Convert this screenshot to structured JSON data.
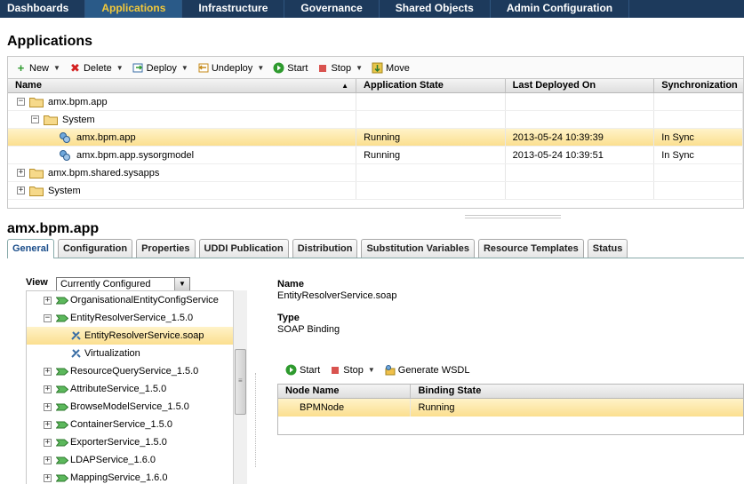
{
  "nav": {
    "tabs": [
      "Dashboards",
      "Applications",
      "Infrastructure",
      "Governance",
      "Shared Objects",
      "Admin Configuration"
    ],
    "active": "Applications"
  },
  "page_title": "Applications",
  "toolbar": {
    "new": "New",
    "delete": "Delete",
    "deploy": "Deploy",
    "undeploy": "Undeploy",
    "start": "Start",
    "stop": "Stop",
    "move": "Move"
  },
  "grid": {
    "columns": [
      "Name",
      "Application State",
      "Last Deployed On",
      "Synchronization"
    ],
    "rows": [
      {
        "name": "amx.bpm.app",
        "state": "",
        "deployed": "",
        "sync": ""
      },
      {
        "name": "System",
        "state": "",
        "deployed": "",
        "sync": ""
      },
      {
        "name": "amx.bpm.app",
        "state": "Running",
        "deployed": "2013-05-24 10:39:39",
        "sync": "In Sync"
      },
      {
        "name": "amx.bpm.app.sysorgmodel",
        "state": "Running",
        "deployed": "2013-05-24 10:39:51",
        "sync": "In Sync"
      },
      {
        "name": "amx.bpm.shared.sysapps",
        "state": "",
        "deployed": "",
        "sync": ""
      },
      {
        "name": "System",
        "state": "",
        "deployed": "",
        "sync": ""
      }
    ]
  },
  "detail_title": "amx.bpm.app",
  "detail_tabs": [
    "General",
    "Configuration",
    "Properties",
    "UDDI Publication",
    "Distribution",
    "Substitution Variables",
    "Resource Templates",
    "Status"
  ],
  "view": {
    "label": "View",
    "selected": "Currently Configured"
  },
  "tree": [
    "OrganisationalEntityConfigService",
    "EntityResolverService_1.5.0",
    "EntityResolverService.soap",
    "Virtualization",
    "ResourceQueryService_1.5.0",
    "AttributeService_1.5.0",
    "BrowseModelService_1.5.0",
    "ContainerService_1.5.0",
    "ExporterService_1.5.0",
    "LDAPService_1.6.0",
    "MappingService_1.6.0"
  ],
  "binding": {
    "name_label": "Name",
    "name_value": "EntityResolverService.soap",
    "type_label": "Type",
    "type_value": "SOAP Binding",
    "start": "Start",
    "stop": "Stop",
    "generate": "Generate WSDL",
    "columns": [
      "Node Name",
      "Binding State"
    ],
    "rows": [
      {
        "node": "BPMNode",
        "state": "Running"
      }
    ]
  },
  "colors": {
    "nav_bg": "#1d3a5c",
    "nav_active_text": "#f3c93a",
    "selection": "#fbdf8f"
  }
}
